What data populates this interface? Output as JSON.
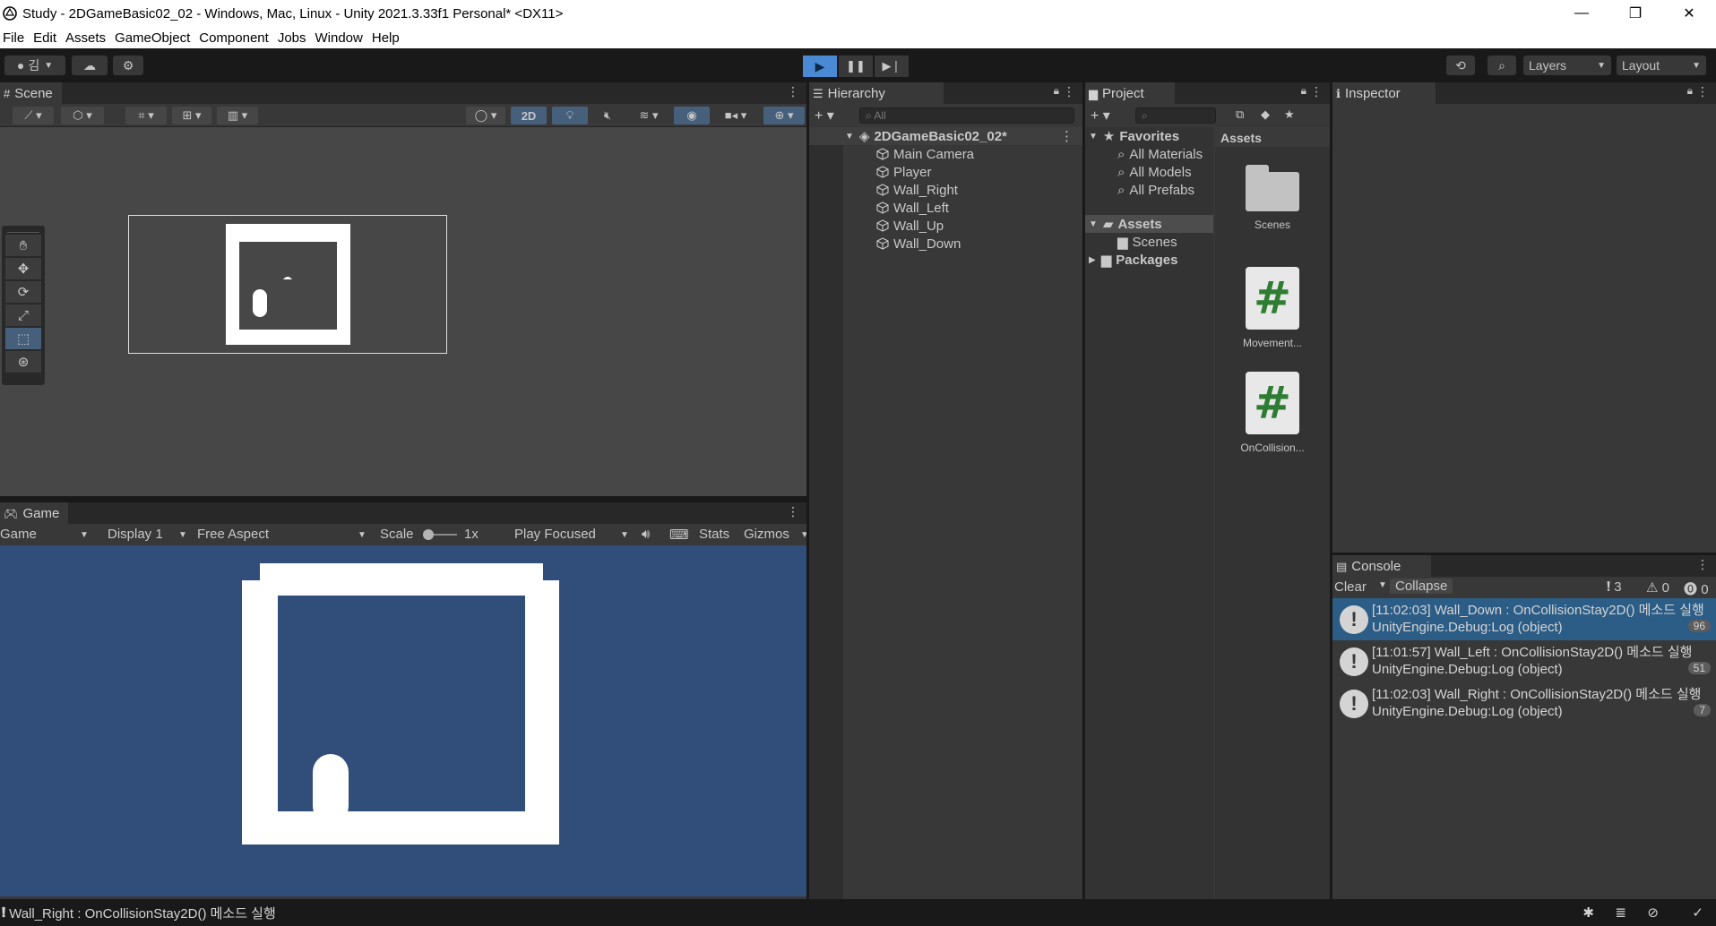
{
  "window": {
    "title": "Study - 2DGameBasic02_02 - Windows, Mac, Linux - Unity 2021.3.33f1 Personal* <DX11>",
    "minimize": "—",
    "restore": "❐",
    "close": "✕"
  },
  "menu": [
    "File",
    "Edit",
    "Assets",
    "GameObject",
    "Component",
    "Jobs",
    "Window",
    "Help"
  ],
  "toolbar": {
    "account": "김",
    "layers_label": "Layers",
    "layout_label": "Layout"
  },
  "scene": {
    "tab_label": "Scene",
    "mode_2d": "2D"
  },
  "game": {
    "tab_label": "Game",
    "view_select": "Game",
    "display_select": "Display 1",
    "aspect_select": "Free Aspect",
    "scale_label": "Scale",
    "scale_value": "1x",
    "play_mode": "Play Focused",
    "stats": "Stats",
    "gizmos": "Gizmos"
  },
  "hierarchy": {
    "tab_label": "Hierarchy",
    "search_placeholder": "All",
    "scene_name": "2DGameBasic02_02*",
    "items": [
      "Main Camera",
      "Player",
      "Wall_Right",
      "Wall_Left",
      "Wall_Up",
      "Wall_Down"
    ]
  },
  "project": {
    "tab_label": "Project",
    "favorites": "Favorites",
    "favorite_items": [
      "All Materials",
      "All Models",
      "All Prefabs"
    ],
    "assets": "Assets",
    "scenes": "Scenes",
    "packages": "Packages",
    "breadcrumb": "Assets",
    "tiles": [
      "Scenes",
      "Movement...",
      "OnCollision..."
    ]
  },
  "inspector": {
    "tab_label": "Inspector"
  },
  "console": {
    "tab_label": "Console",
    "clear": "Clear",
    "collapse": "Collapse",
    "info_count": "3",
    "warn_count": "0",
    "error_count": "0",
    "logs": [
      {
        "line1": "[11:02:03] Wall_Down : OnCollisionStay2D() 메소드 실행",
        "line2": "UnityEngine.Debug:Log (object)",
        "count": "96"
      },
      {
        "line1": "[11:01:57] Wall_Left : OnCollisionStay2D() 메소드 실행",
        "line2": "UnityEngine.Debug:Log (object)",
        "count": "51"
      },
      {
        "line1": "[11:02:03] Wall_Right : OnCollisionStay2D() 메소드 실행",
        "line2": "UnityEngine.Debug:Log (object)",
        "count": "7"
      }
    ]
  },
  "status": {
    "message": "Wall_Right : OnCollisionStay2D() 메소드 실행"
  },
  "colors": {
    "game_background": "#314d79",
    "scene_background": "#474747",
    "play_active": "#4a8ad4",
    "selected_log": "#2c5d87"
  }
}
